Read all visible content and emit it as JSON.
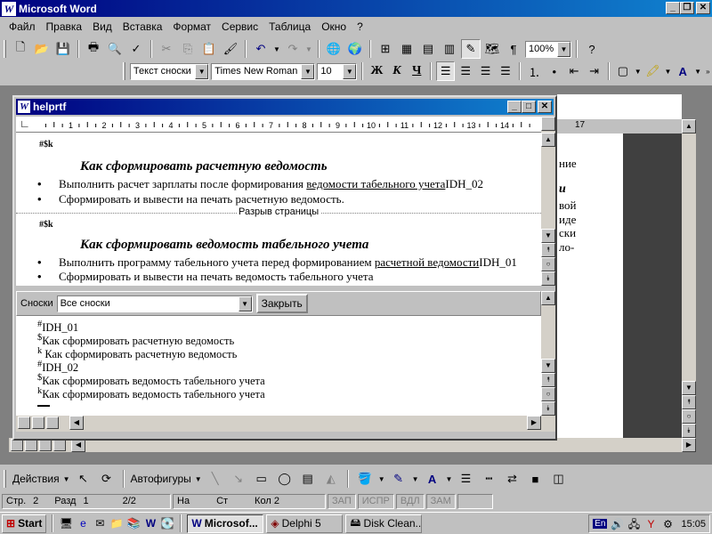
{
  "app": {
    "title": "Microsoft Word"
  },
  "menu": [
    "Файл",
    "Правка",
    "Вид",
    "Вставка",
    "Формат",
    "Сервис",
    "Таблица",
    "Окно",
    "?"
  ],
  "toolbar": {
    "zoom": "100%",
    "style": "Текст сноски",
    "font": "Times New Roman",
    "size": "10",
    "bold": "Ж",
    "italic": "К",
    "underline": "Ч"
  },
  "document": {
    "title": "helprtf",
    "ruler_numbers": [
      "1",
      "2",
      "3",
      "4",
      "5",
      "6",
      "7",
      "8",
      "9",
      "10",
      "11",
      "12",
      "13",
      "14",
      "15",
      "16",
      "17"
    ],
    "fn_marks_1": "#$k",
    "heading_1": "Как сформировать расчетную ведомость",
    "bullet_1_text": "Выполнить расчет зарплаты после формирования ",
    "bullet_1_link": "ведомости табельного учета",
    "bullet_1_id": "IDH_02",
    "bullet_2": "Сформировать и вывести на печать расчетную ведомость.",
    "page_break": "Разрыв страницы",
    "fn_marks_2": "#$k",
    "heading_2": "Как сформировать ведомость табельного учета",
    "bullet_3_text": "Выполнить программу табельного учета перед формированием ",
    "bullet_3_link": "расчетной ведомости",
    "bullet_3_id": "IDH_01",
    "bullet_4": "Сформировать и вывести на печать ведомость табельного учета"
  },
  "footnotes": {
    "label": "Сноски",
    "filter": "Все сноски",
    "close_button": "Закрыть",
    "items": [
      {
        "mark": "#",
        "text": "IDH_01"
      },
      {
        "mark": "$",
        "text": "Как сформировать расчетную ведомость"
      },
      {
        "mark": "k",
        "text": " Как сформировать расчетную ведомость"
      },
      {
        "mark": "#",
        "text": "IDH_02"
      },
      {
        "mark": "$",
        "text": "Как сформировать ведомость табельного учета"
      },
      {
        "mark": "k",
        "text": "Как сформировать ведомость табельного учета"
      }
    ]
  },
  "background_doc": {
    "fragments": [
      "ние",
      "и",
      "вой",
      "иде",
      "ски",
      "ло-"
    ],
    "ruler_number": "17"
  },
  "drawing": {
    "actions": "Действия",
    "autoshapes": "Автофигуры"
  },
  "status": {
    "page": "Стр.",
    "page_num": "2",
    "section": "Разд",
    "section_num": "1",
    "pages": "2/2",
    "at": "На",
    "line": "Ст",
    "col": "Кол",
    "col_num": "2",
    "rec": "ЗАП",
    "trk": "ИСПР",
    "ext": "ВДЛ",
    "ovr": "ЗАМ"
  },
  "taskbar": {
    "start": "Start",
    "tasks": [
      "Microsof...",
      "Delphi 5",
      "Disk Clean..."
    ],
    "lang": "En",
    "clock": "15:05"
  }
}
